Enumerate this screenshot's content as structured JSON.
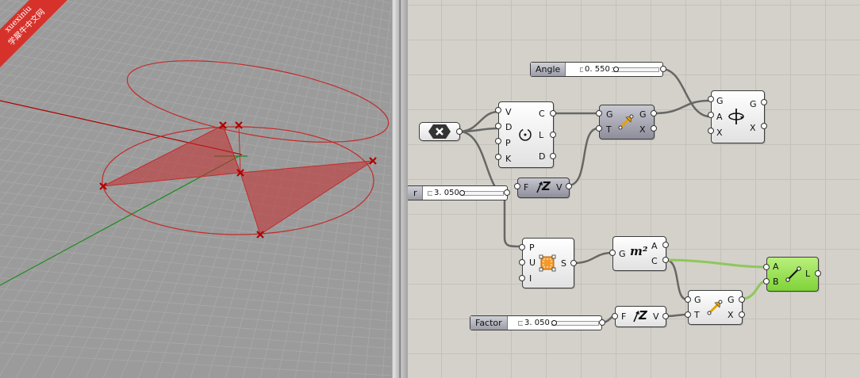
{
  "watermark": {
    "line1": "xuexiniu",
    "line2": "学犀牛中文网"
  },
  "sliders": {
    "angle": {
      "name": "Angle",
      "value": "0. 550"
    },
    "factor_top": {
      "name": "r",
      "value": "3. 050"
    },
    "factor_bottom": {
      "name": "Factor",
      "value": "3. 050"
    }
  },
  "components": {
    "polygon": {
      "inputs": [
        "V",
        "D",
        "P",
        "K"
      ],
      "outputs": [
        "C",
        "L",
        "D"
      ]
    },
    "move_top": {
      "inputs": [
        "G",
        "T"
      ],
      "outputs": [
        "G",
        "X"
      ]
    },
    "rotate": {
      "inputs": [
        "G",
        "A",
        "X"
      ],
      "outputs": [
        "G",
        "X"
      ]
    },
    "unit_z_top": {
      "input": "F",
      "glyph": "Z",
      "output": "V"
    },
    "region": {
      "inputs": [
        "P",
        "U",
        "I"
      ],
      "output": "S"
    },
    "area": {
      "input": "G",
      "glyph": "m²",
      "outputs": [
        "A",
        "C"
      ]
    },
    "line": {
      "inputs": [
        "A",
        "B"
      ],
      "output": "L"
    },
    "move_bottom": {
      "inputs": [
        "G",
        "T"
      ],
      "outputs": [
        "G",
        "X"
      ]
    },
    "unit_z_bottom": {
      "input": "F",
      "glyph": "Z",
      "output": "V"
    }
  },
  "colors": {
    "viewport_bg": "#9b9b9b",
    "canvas_bg": "#d3d1c9",
    "geometry": "#c42b2b",
    "line_component": "#8fe04a"
  }
}
